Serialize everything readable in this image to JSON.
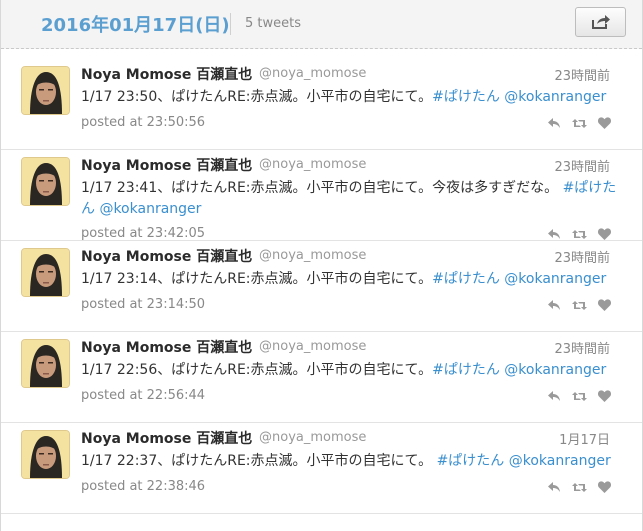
{
  "header": {
    "date": "2016年01月17日(日)",
    "count": "5 tweets"
  },
  "colors": {
    "accent": "#5b9fd1",
    "link": "#3a8fcf"
  },
  "icons": {
    "share": "share-icon",
    "reply": "reply-icon",
    "retweet": "retweet-icon",
    "favorite": "heart-icon"
  },
  "tweets": [
    {
      "name": "Noya Momose 百瀬直也",
      "handle": "@noya_momose",
      "time": "23時間前",
      "text_plain": "1/17 23:50、ぱけたんRE:赤点滅。小平市の自宅にて。",
      "hashtag": "#ぱけたん",
      "mention": "@kokanranger",
      "posted": "posted at 23:50:56"
    },
    {
      "name": "Noya Momose 百瀬直也",
      "handle": "@noya_momose",
      "time": "23時間前",
      "text_plain": "1/17 23:41、ぱけたんRE:赤点滅。小平市の自宅にて。今夜は多すぎだな。",
      "hashtag": "#ぱけたん",
      "mention": "@kokanranger",
      "posted": "posted at 23:42:05"
    },
    {
      "name": "Noya Momose 百瀬直也",
      "handle": "@noya_momose",
      "time": "23時間前",
      "text_plain": "1/17 23:14、ぱけたんRE:赤点滅。小平市の自宅にて。",
      "hashtag": "#ぱけたん",
      "mention": "@kokanranger",
      "posted": "posted at 23:14:50"
    },
    {
      "name": "Noya Momose 百瀬直也",
      "handle": "@noya_momose",
      "time": "23時間前",
      "text_plain": "1/17 22:56、ぱけたんRE:赤点滅。小平市の自宅にて。",
      "hashtag": "#ぱけたん",
      "mention": "@kokanranger",
      "posted": "posted at 22:56:44"
    },
    {
      "name": "Noya Momose 百瀬直也",
      "handle": "@noya_momose",
      "time": "1月17日",
      "text_plain": "1/17 22:37、ぱけたんRE:赤点滅。小平市の自宅にて。",
      "hashtag": "#ぱけたん",
      "mention": "@kokanranger",
      "posted": "posted at 22:38:46"
    }
  ]
}
